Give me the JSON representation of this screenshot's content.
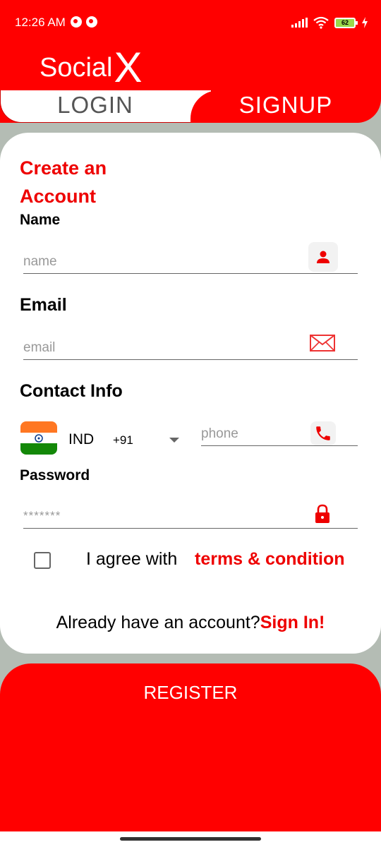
{
  "status": {
    "time": "12:26 AM",
    "battery": "62"
  },
  "app": {
    "logo_text": "Social",
    "logo_x": "X"
  },
  "tabs": {
    "login": "LOGIN",
    "signup": "SIGNUP"
  },
  "form": {
    "title": "Create an Account",
    "name_label": "Name",
    "name_placeholder": "name",
    "email_label": "Email",
    "email_placeholder": "email",
    "contact_label": "Contact Info",
    "country": "IND",
    "dial_code": "+91",
    "phone_placeholder": "phone",
    "password_label": "Password",
    "password_value": "*******",
    "agree_text": "I agree with",
    "terms_link": "terms & condition",
    "already_text": "Already have an account?",
    "signin_link": "Sign In!"
  },
  "actions": {
    "register": "REGISTER"
  },
  "icons": {
    "name_field": "person-icon",
    "email_field": "envelope-icon",
    "phone_field": "phone-icon",
    "password_field": "lock-icon",
    "country": "india-flag-icon"
  },
  "colors": {
    "accent": "#ff0000",
    "accent_text": "#e00000",
    "background": "#b4bcb4",
    "card": "#ffffff"
  }
}
